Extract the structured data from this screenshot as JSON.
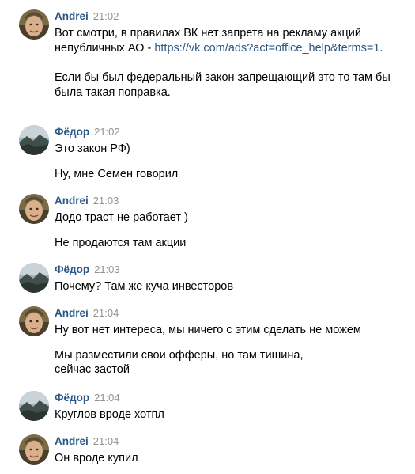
{
  "conversation": {
    "messages": [
      {
        "author": "Andrei",
        "time": "21:02",
        "avatar": "andrei-avatar",
        "line1_prefix": "Вот смотри, в правилах ВК нет запрета на рекламу акций непубличных АО - ",
        "line1_link": "https://vk.com/ads?act=office_help&terms=1",
        "line1_suffix": ".",
        "line2": "Если бы был федеральный закон запрещающий это то там бы была такая поправка."
      },
      {
        "author": "Фёдор",
        "time": "21:02",
        "avatar": "fedor-avatar",
        "line1": "Это закон РФ)",
        "line2": "Ну, мне Семен говорил"
      },
      {
        "author": "Andrei",
        "time": "21:03",
        "avatar": "andrei-avatar",
        "line1": "Додо траст не работает )",
        "line2": "Не продаются там акции"
      },
      {
        "author": "Фёдор",
        "time": "21:03",
        "avatar": "fedor-avatar",
        "line1": "Почему? Там же куча инвесторов"
      },
      {
        "author": "Andrei",
        "time": "21:04",
        "avatar": "andrei-avatar",
        "line1": "Ну вот нет интереса, мы ничего с этим сделать не можем",
        "line2": "Мы разместили свои офферы, но там тишина, сейчас застой"
      },
      {
        "author": "Фёдор",
        "time": "21:04",
        "avatar": "fedor-avatar",
        "line1": "Круглов вроде хотпл"
      },
      {
        "author": "Andrei",
        "time": "21:04",
        "avatar": "andrei-avatar",
        "line1": "Он вроде купил"
      }
    ]
  },
  "colors": {
    "author": "#2a5885",
    "link": "#2a5885",
    "time": "#939393",
    "text": "#000000",
    "background": "#ffffff"
  }
}
